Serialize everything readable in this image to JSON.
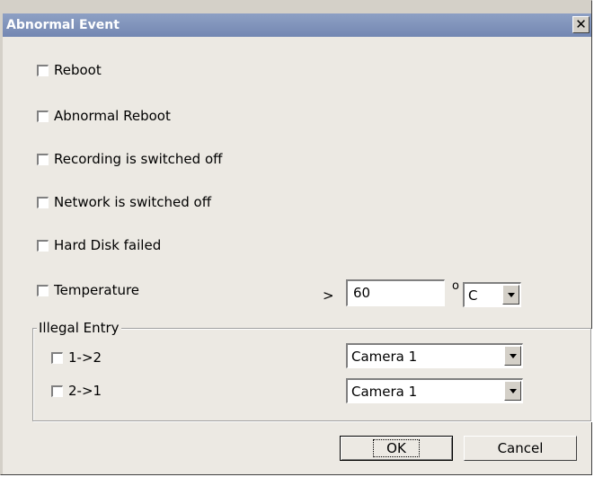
{
  "window": {
    "title": "Abnormal Event",
    "close_glyph": "✕"
  },
  "events": [
    {
      "label": "Reboot",
      "checked": false
    },
    {
      "label": "Abnormal Reboot",
      "checked": false
    },
    {
      "label": "Recording is switched off",
      "checked": false
    },
    {
      "label": "Network is switched off",
      "checked": false
    },
    {
      "label": "Hard Disk failed",
      "checked": false
    },
    {
      "label": "Temperature",
      "checked": false
    }
  ],
  "temperature": {
    "comparator": ">",
    "value": "60",
    "degree_symbol": "o",
    "unit": "C"
  },
  "illegal_entry": {
    "legend": "Illegal Entry",
    "rows": [
      {
        "label": "1->2",
        "checked": false,
        "camera": "Camera 1"
      },
      {
        "label": "2->1",
        "checked": false,
        "camera": "Camera 1"
      }
    ]
  },
  "buttons": {
    "ok": "OK",
    "cancel": "Cancel"
  }
}
